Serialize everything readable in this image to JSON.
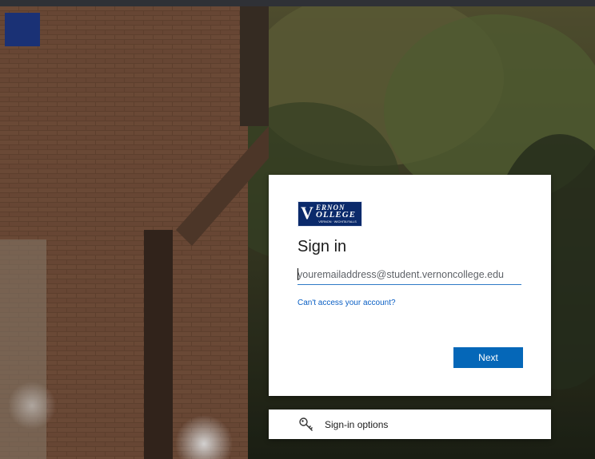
{
  "logo": {
    "line1": "ERNON",
    "line2": "OLLEGE",
    "monogram": "V",
    "subtitle": "VERNON · WICHITA FALLS",
    "brand_color": "#0b2a6b"
  },
  "signin": {
    "title": "Sign in",
    "email_placeholder": "youremailaddress@student.vernoncollege.edu",
    "cant_access_link": "Can't access your account?",
    "next_label": "Next"
  },
  "options": {
    "label": "Sign-in options",
    "icon": "key-icon"
  },
  "colors": {
    "accent": "#0567b8",
    "link": "#0a5fc4"
  }
}
